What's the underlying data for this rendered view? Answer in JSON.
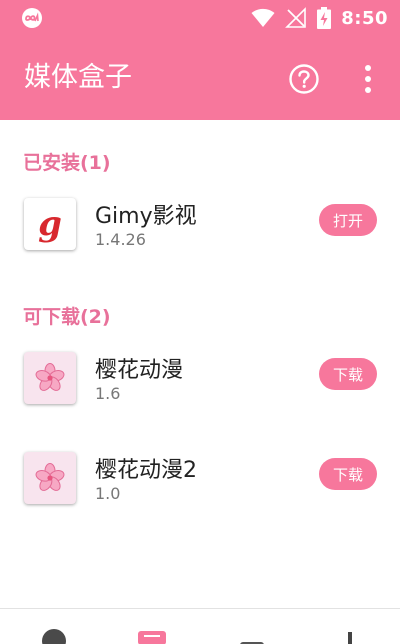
{
  "status_bar": {
    "time": "8:50",
    "icons": [
      "app-notification-icon",
      "wifi-icon",
      "no-signal-icon",
      "battery-charging-icon"
    ]
  },
  "app_bar": {
    "title": "媒体盒子",
    "actions": [
      "help-icon",
      "more-vert-icon"
    ]
  },
  "sections": [
    {
      "header": "已安装(1)",
      "apps": [
        {
          "name": "Gimy影视",
          "version": "1.4.26",
          "action": "打开",
          "icon": "gimy-logo-icon"
        }
      ]
    },
    {
      "header": "可下载(2)",
      "apps": [
        {
          "name": "樱花动漫",
          "version": "1.6",
          "action": "下载",
          "icon": "sakura-icon"
        },
        {
          "name": "樱花动漫2",
          "version": "1.0",
          "action": "下载",
          "icon": "sakura-icon"
        }
      ]
    }
  ],
  "bottom_nav": {
    "items": [
      "home-icon",
      "media-box-icon",
      "tv-icon",
      "person-icon"
    ],
    "active_index": 1
  },
  "colors": {
    "accent": "#f7779c",
    "section_header": "#e8719a",
    "sakura_bg": "#f8e4ee"
  }
}
